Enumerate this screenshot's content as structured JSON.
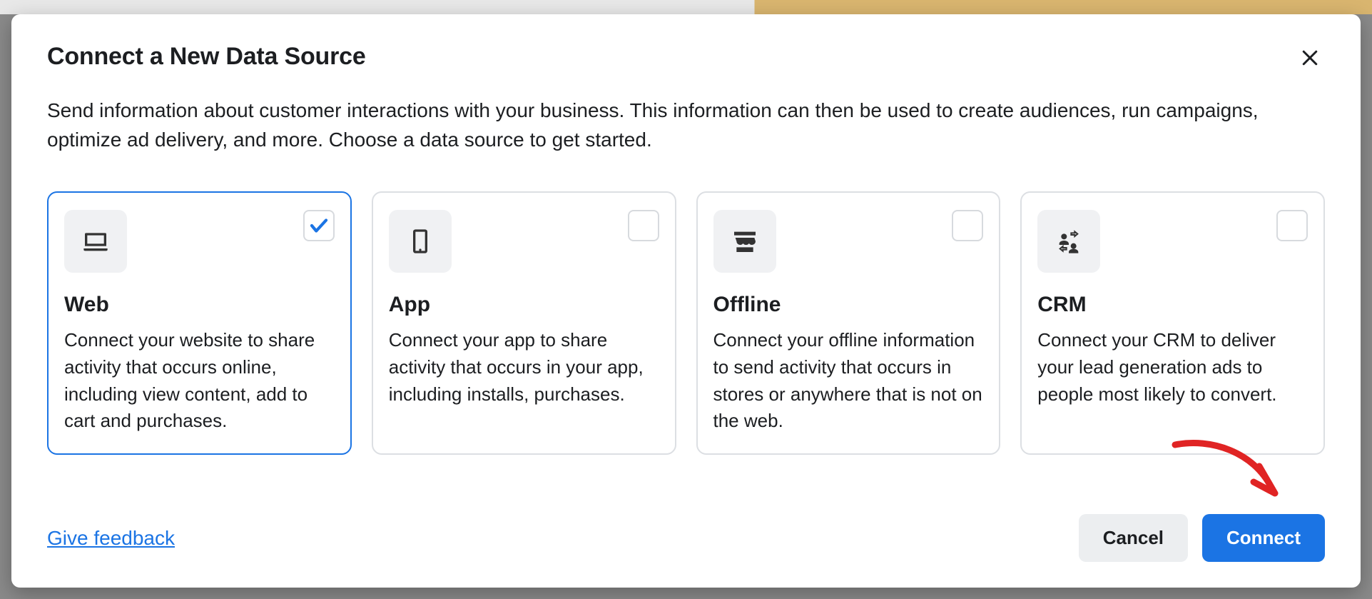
{
  "modal": {
    "title": "Connect a New Data Source",
    "subtitle": "Send information about customer interactions with your business. This information can then be used to create audiences, run campaigns, optimize ad delivery, and more. Choose a data source to get started."
  },
  "cards": [
    {
      "icon": "laptop-icon",
      "title": "Web",
      "desc": "Connect your website to share activity that occurs online, including view content, add to cart and purchases.",
      "selected": true
    },
    {
      "icon": "mobile-icon",
      "title": "App",
      "desc": "Connect your app to share activity that occurs in your app, including installs, purchases.",
      "selected": false
    },
    {
      "icon": "store-icon",
      "title": "Offline",
      "desc": "Connect your offline information to send activity that occurs in stores or anywhere that is not on the web.",
      "selected": false
    },
    {
      "icon": "crm-icon",
      "title": "CRM",
      "desc": "Connect your CRM to deliver your lead generation ads to people most likely to convert.",
      "selected": false
    }
  ],
  "footer": {
    "feedback": "Give feedback",
    "cancel": "Cancel",
    "connect": "Connect"
  },
  "colors": {
    "primary": "#1b74e4",
    "annotation": "#e02424"
  }
}
